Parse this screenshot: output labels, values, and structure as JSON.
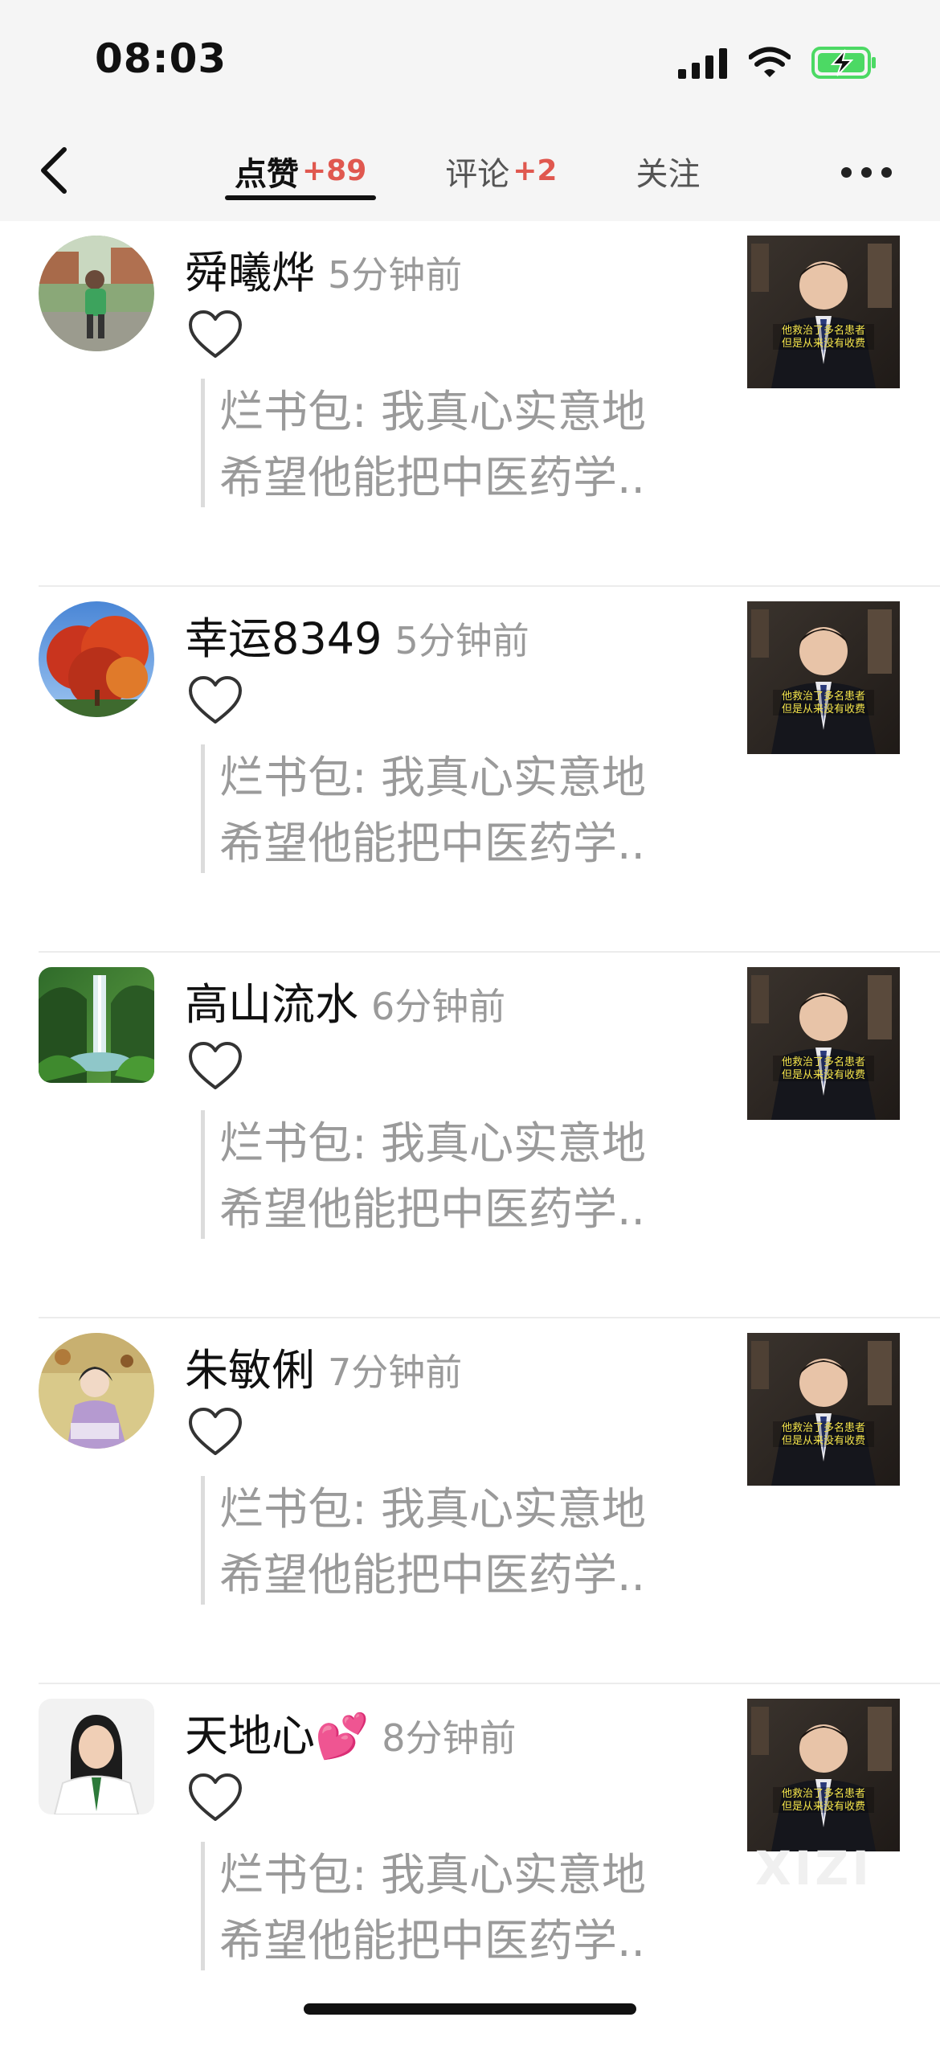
{
  "status_bar": {
    "time": "08:03",
    "battery_color": "#4cd964"
  },
  "nav": {
    "tabs": [
      {
        "label": "点赞",
        "count": "+89",
        "active": true
      },
      {
        "label": "评论",
        "count": "+2",
        "active": false
      },
      {
        "label": "关注",
        "count": "",
        "active": false
      }
    ],
    "accent_color": "#e0584f"
  },
  "items": [
    {
      "name": "舜曦烨",
      "time": "5分钟前",
      "quote_line1": "烂书包: 我真心实意地",
      "quote_line2": "希望他能把中医药学..",
      "avatar": "boy-outdoor-photo"
    },
    {
      "name": "幸运8349",
      "time": "5分钟前",
      "quote_line1": "烂书包: 我真心实意地",
      "quote_line2": "希望他能把中医药学..",
      "avatar": "red-tree-photo"
    },
    {
      "name": "高山流水",
      "time": "6分钟前",
      "quote_line1": "烂书包: 我真心实意地",
      "quote_line2": "希望他能把中医药学..",
      "avatar": "waterfall-photo"
    },
    {
      "name": "朱敏俐",
      "time": "7分钟前",
      "quote_line1": "烂书包: 我真心实意地",
      "quote_line2": "希望他能把中医药学..",
      "avatar": "illustration-woman"
    },
    {
      "name": "天地心💕",
      "time": "8分钟前",
      "quote_line1": "烂书包: 我真心实意地",
      "quote_line2": "希望他能把中医药学..",
      "avatar": "woman-portrait"
    }
  ],
  "thumbnail_caption_line1": "他救治了多名患者",
  "thumbnail_caption_line2": "但是从来没有收费",
  "watermark": "XIZI"
}
